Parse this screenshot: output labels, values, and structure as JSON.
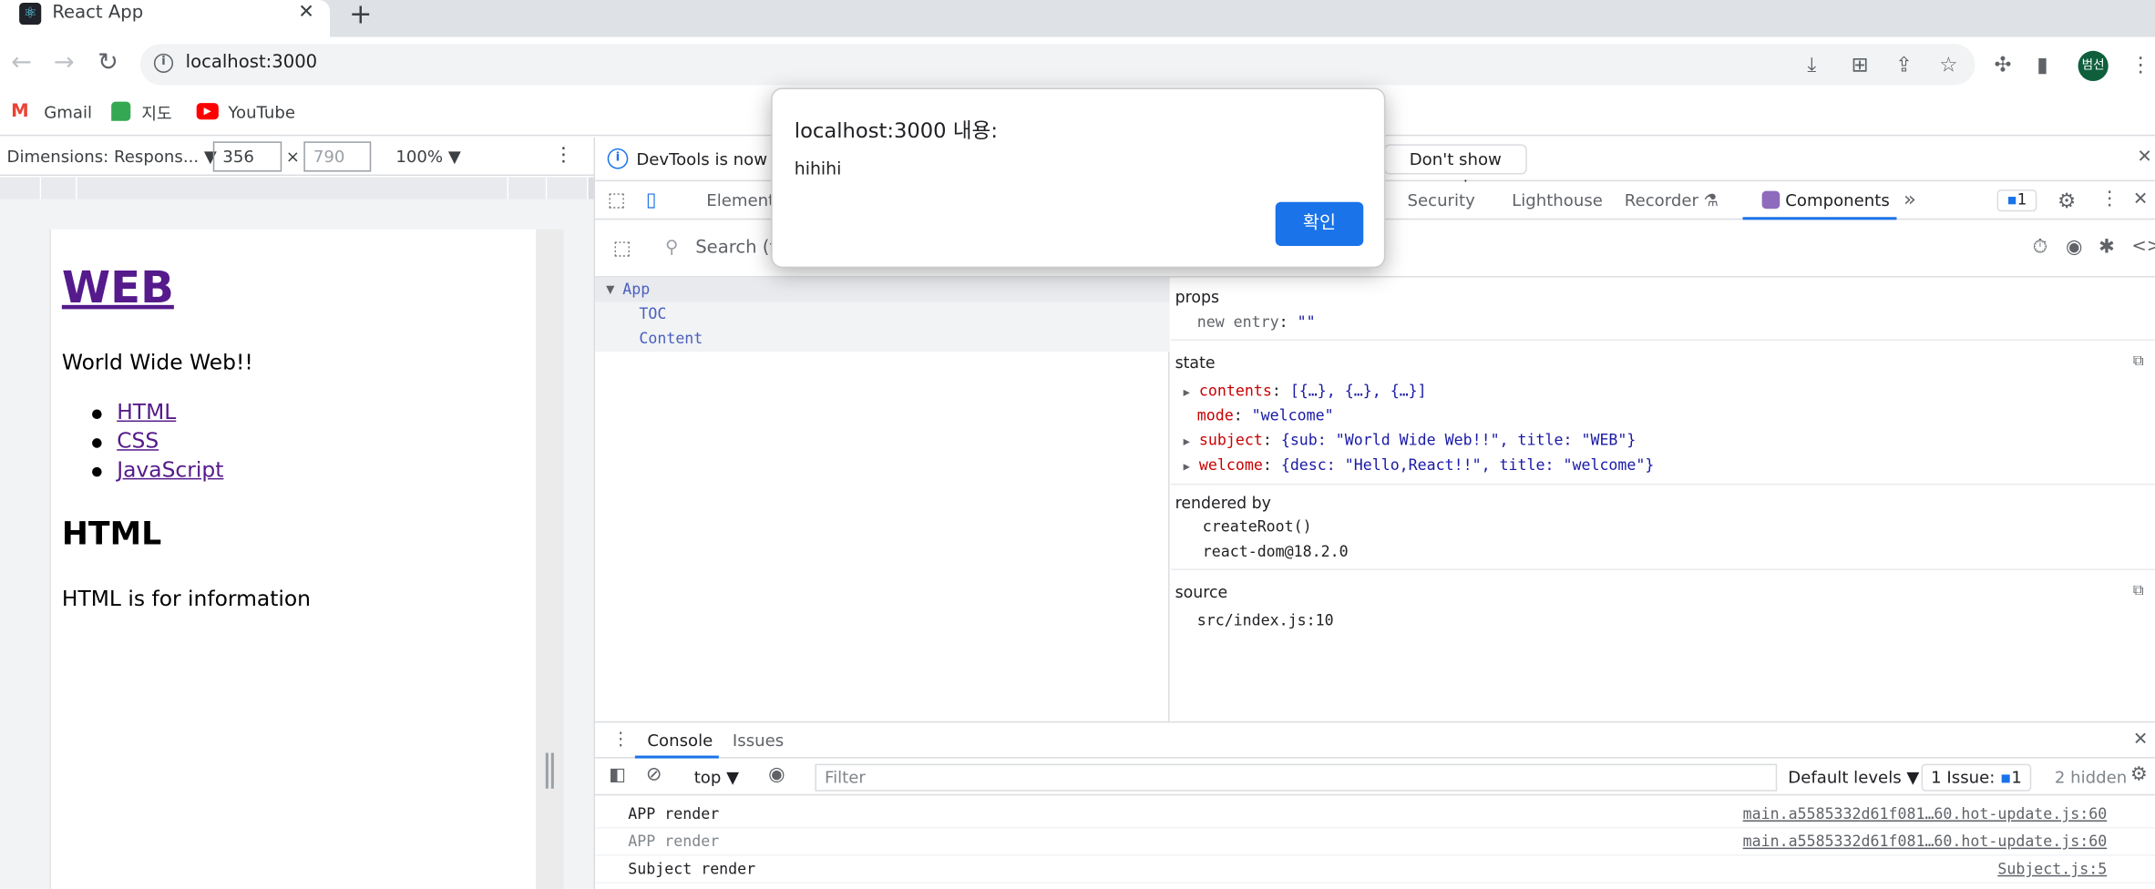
{
  "browser": {
    "tab_title": "React App",
    "tab_icon": "react-logo-icon",
    "url": "localhost:3000",
    "avatar_text": "범선",
    "bookmarks": [
      {
        "label": "Gmail",
        "icon": "gmail-icon"
      },
      {
        "label": "지도",
        "icon": "maps-icon"
      },
      {
        "label": "YouTube",
        "icon": "youtube-icon"
      }
    ]
  },
  "device_toolbar": {
    "dimensions_label": "Dimensions: Respons...",
    "width": "356",
    "height_placeholder": "790",
    "times": "×",
    "zoom": "100%"
  },
  "page": {
    "heading": "WEB",
    "subtitle": "World Wide Web!!",
    "links": [
      "HTML",
      "CSS",
      "JavaScript"
    ],
    "content_heading": "HTML",
    "content_desc": "HTML is for information"
  },
  "devtools": {
    "infobar_text": "DevTools is now av",
    "dont_show_label": "Don't show again",
    "tabs": [
      "Elements",
      "Security",
      "Lighthouse",
      "Recorder",
      "Components"
    ],
    "active_tab": "Components",
    "issues_count": "1",
    "search_placeholder": "Search (t",
    "tree": [
      {
        "label": "App",
        "selected": true
      },
      {
        "label": "TOC",
        "selected": false
      },
      {
        "label": "Content",
        "selected": false
      }
    ],
    "props_title": "props",
    "props_line": {
      "key": "new entry",
      "value": "\"\""
    },
    "state_title": "state",
    "state": [
      {
        "key": "contents",
        "value": "[{…}, {…}, {…}]",
        "expandable": true
      },
      {
        "key": "mode",
        "value": "\"welcome\"",
        "expandable": false
      },
      {
        "key": "subject",
        "value": "{sub: \"World Wide Web!!\", title: \"WEB\"}",
        "expandable": true
      },
      {
        "key": "welcome",
        "value": "{desc: \"Hello,React!!\", title: \"welcome\"}",
        "expandable": true
      }
    ],
    "rendered_by_title": "rendered by",
    "rendered_by": [
      "createRoot()",
      "react-dom@18.2.0"
    ],
    "source_title": "source",
    "source": "src/index.js:10"
  },
  "console": {
    "tabs": [
      "Console",
      "Issues"
    ],
    "context": "top",
    "filter_placeholder": "Filter",
    "levels": "Default levels ▼",
    "issue_label": "1 Issue:",
    "issue_count": "1",
    "hidden": "2 hidden",
    "lines": [
      {
        "msg": "APP render",
        "src": "main.a5585332d61f081…60.hot-update.js:60",
        "dim": false
      },
      {
        "msg": "APP render",
        "src": "main.a5585332d61f081…60.hot-update.js:60",
        "dim": true
      },
      {
        "msg": "Subject render",
        "src": "Subject.js:5",
        "dim": false
      }
    ]
  },
  "alert": {
    "title": "localhost:3000 내용:",
    "message": "hihihi",
    "ok_label": "확인"
  },
  "colors": {
    "accent": "#1a73e8",
    "link_visited": "#551a8b",
    "key": "#c80000"
  }
}
